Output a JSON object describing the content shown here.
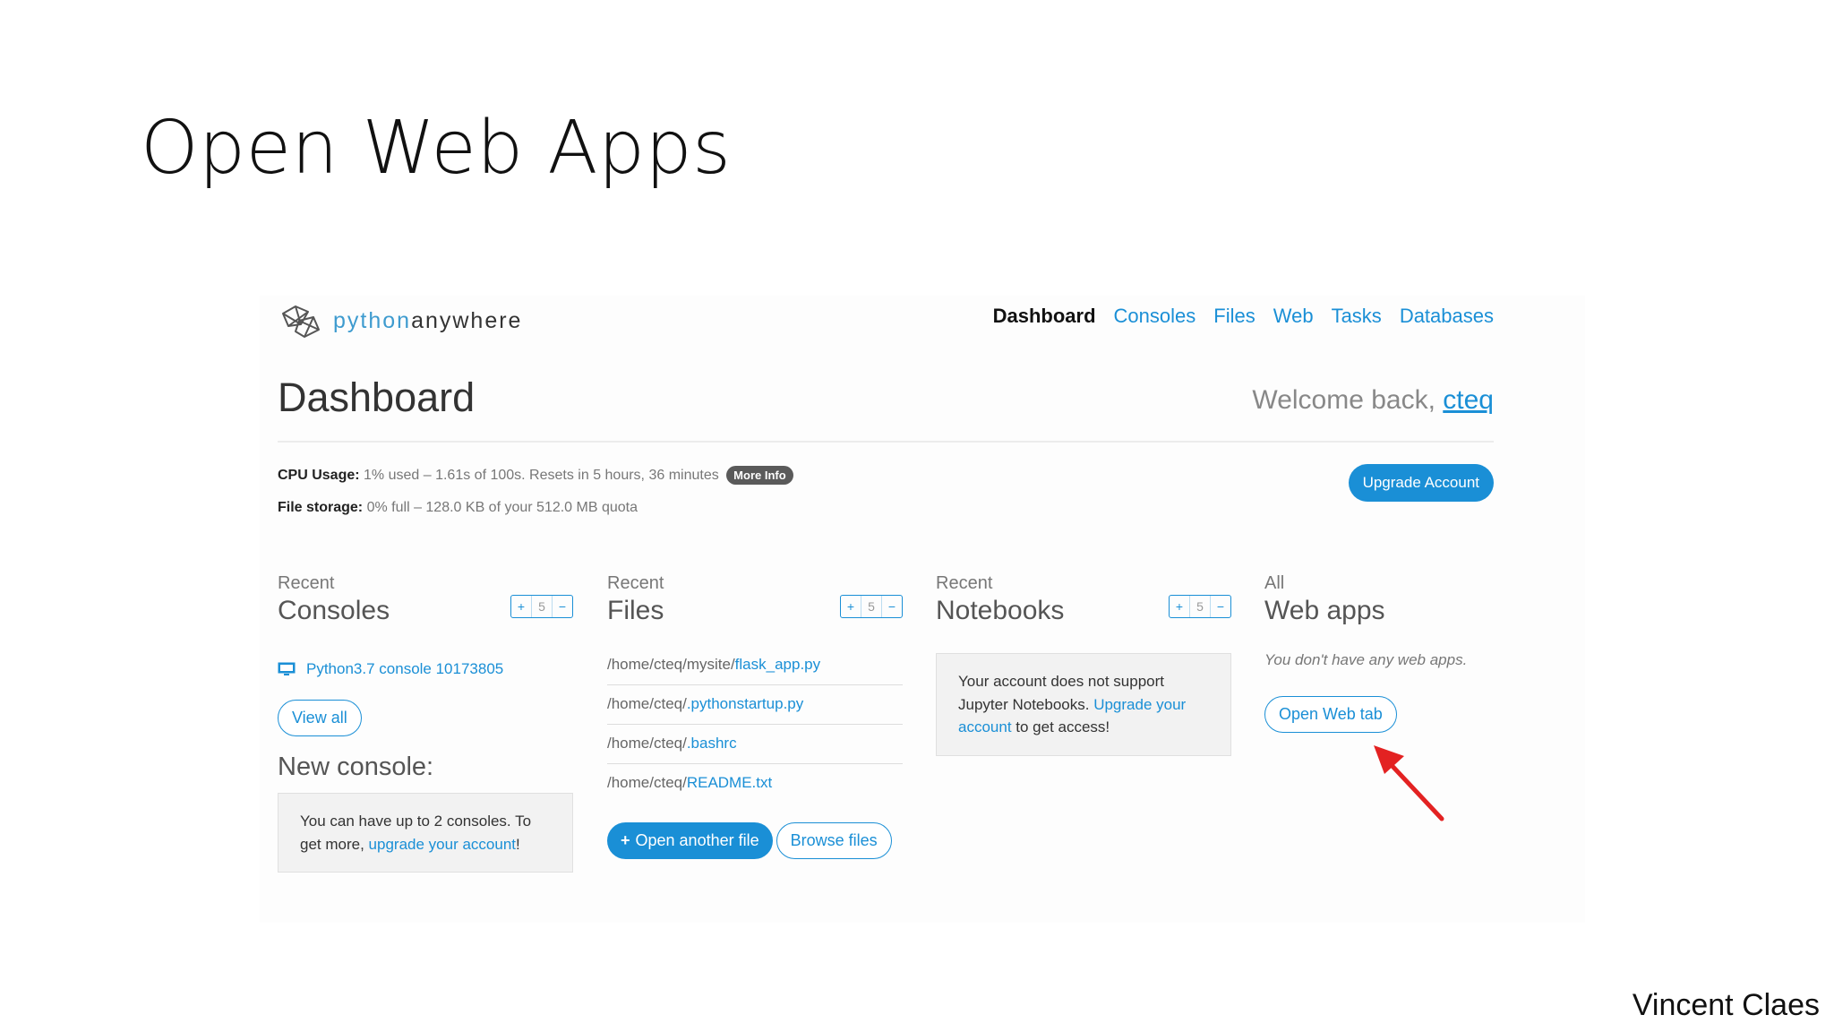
{
  "slide": {
    "title": "Open Web Apps",
    "author": "Vincent Claes"
  },
  "header": {
    "logo_python": "python",
    "logo_anywhere": "anywhere",
    "nav": [
      "Dashboard",
      "Consoles",
      "Files",
      "Web",
      "Tasks",
      "Databases"
    ],
    "active_nav": "Dashboard"
  },
  "page": {
    "title": "Dashboard",
    "welcome_prefix": "Welcome back, ",
    "username": "cteq"
  },
  "usage": {
    "cpu_label": "CPU Usage:",
    "cpu_text": "1% used – 1.61s of 100s. Resets in 5 hours, 36 minutes",
    "more_info": "More Info",
    "storage_label": "File storage:",
    "storage_text": "0% full – 128.0 KB of your 512.0 MB quota",
    "upgrade_button": "Upgrade Account"
  },
  "consoles": {
    "small": "Recent",
    "big": "Consoles",
    "count": "5",
    "items": [
      "Python3.7 console 10173805"
    ],
    "view_all": "View all",
    "new_console_heading": "New console:",
    "note_prefix": "You can have up to 2 consoles. To get more, ",
    "note_link": "upgrade your account",
    "note_suffix": "!"
  },
  "files": {
    "small": "Recent",
    "big": "Files",
    "count": "5",
    "items": [
      {
        "dir": "/home/cteq/mysite/",
        "name": "flask_app.py"
      },
      {
        "dir": "/home/cteq/",
        "name": ".pythonstartup.py"
      },
      {
        "dir": "/home/cteq/",
        "name": ".bashrc"
      },
      {
        "dir": "/home/cteq/",
        "name": "README.txt"
      }
    ],
    "open_button": "Open another file",
    "browse_button": "Browse files"
  },
  "notebooks": {
    "small": "Recent",
    "big": "Notebooks",
    "count": "5",
    "note_prefix": "Your account does not support Jupyter Notebooks. ",
    "note_link": "Upgrade your account",
    "note_suffix": " to get access!"
  },
  "webapps": {
    "small": "All",
    "big": "Web apps",
    "empty_note": "You don't have any web apps.",
    "open_button": "Open Web tab"
  },
  "colors": {
    "accent": "#1a8fd6",
    "arrow": "#e32222"
  }
}
